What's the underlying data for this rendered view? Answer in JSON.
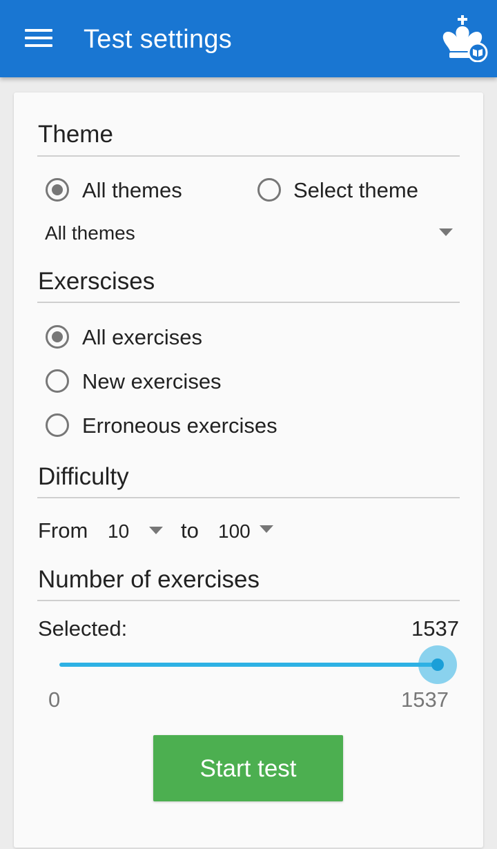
{
  "app_bar": {
    "title": "Test settings",
    "color": "#1976d2",
    "menu_icon": "hamburger-menu-icon",
    "logo_icon": "chess-king-book-icon"
  },
  "theme": {
    "heading": "Theme",
    "options": [
      {
        "label": "All themes",
        "checked": true
      },
      {
        "label": "Select theme",
        "checked": false
      }
    ],
    "dropdown_value": "All themes"
  },
  "exercises": {
    "heading": "Exerscises",
    "options": [
      {
        "label": "All exercises",
        "checked": true
      },
      {
        "label": "New exercises",
        "checked": false
      },
      {
        "label": "Erroneous exercises",
        "checked": false
      }
    ]
  },
  "difficulty": {
    "heading": "Difficulty",
    "from_label": "From",
    "from_value": "10",
    "to_label": "to",
    "to_value": "100"
  },
  "count": {
    "heading": "Number of exercises",
    "selected_label": "Selected:",
    "selected_value": "1537",
    "min_label": "0",
    "max_label": "1537",
    "slider": {
      "min": 0,
      "max": 1537,
      "value": 1537
    },
    "accent": "#2db1e4"
  },
  "actions": {
    "start_label": "Start test",
    "start_color": "#4caf50"
  }
}
